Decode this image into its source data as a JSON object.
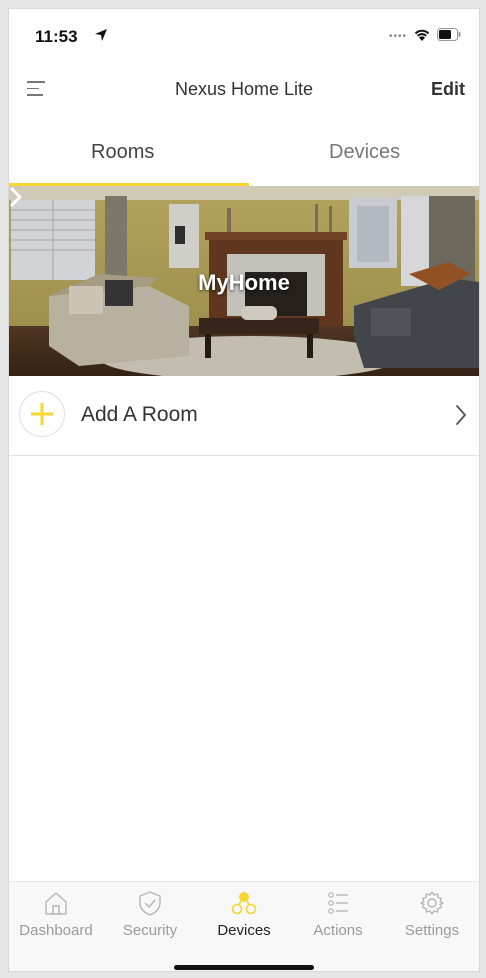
{
  "status_bar": {
    "time": "11:53"
  },
  "navbar": {
    "title": "Nexus Home Lite",
    "edit_label": "Edit"
  },
  "tabs": {
    "rooms_label": "Rooms",
    "devices_label": "Devices",
    "active": "Rooms"
  },
  "rooms": [
    {
      "name": "MyHome"
    }
  ],
  "add_room": {
    "label": "Add A Room"
  },
  "tabbar": {
    "items": [
      {
        "label": "Dashboard",
        "icon": "house-icon",
        "active": false
      },
      {
        "label": "Security",
        "icon": "shield-icon",
        "active": false
      },
      {
        "label": "Devices",
        "icon": "devices-icon",
        "active": true
      },
      {
        "label": "Actions",
        "icon": "list-icon",
        "active": false
      },
      {
        "label": "Settings",
        "icon": "gear-icon",
        "active": false
      }
    ]
  },
  "colors": {
    "accent": "#f6d630",
    "inactive": "#9a9a9a",
    "text": "#333333"
  }
}
